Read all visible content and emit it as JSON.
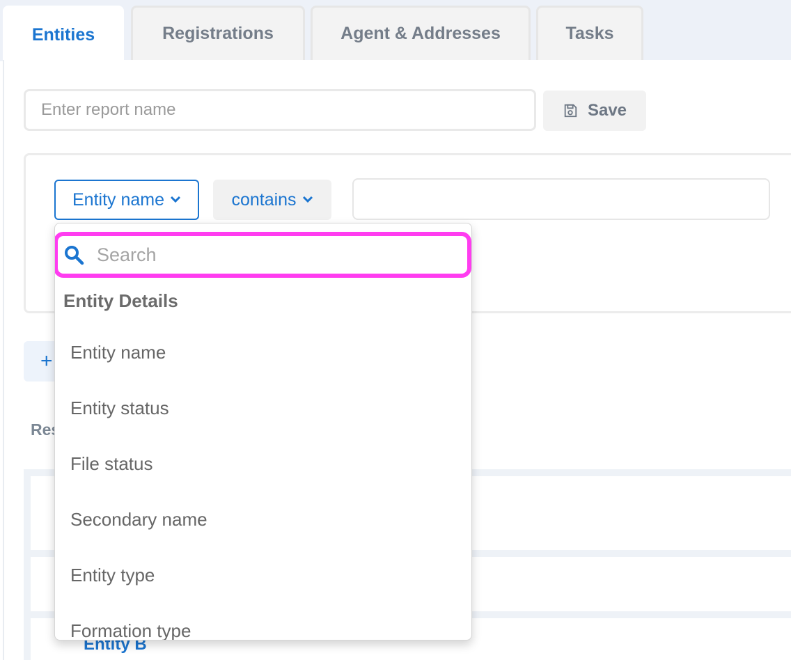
{
  "tabs": [
    {
      "label": "Entities",
      "active": true
    },
    {
      "label": "Registrations",
      "active": false
    },
    {
      "label": "Agent & Addresses",
      "active": false
    },
    {
      "label": "Tasks",
      "active": false
    }
  ],
  "report": {
    "name_placeholder": "Enter report name",
    "name_value": "",
    "save_label": "Save"
  },
  "filter": {
    "field_selected": "Entity name",
    "operator_selected": "contains",
    "value": ""
  },
  "dropdown": {
    "search_placeholder": "Search",
    "group_heading": "Entity Details",
    "items": [
      "Entity name",
      "Entity status",
      "File status",
      "Secondary name",
      "Entity type",
      "Formation type"
    ]
  },
  "background": {
    "add_symbol": "+",
    "results_label_partial": "Res",
    "visible_row_link": "Entity B"
  },
  "colors": {
    "accent": "#1b75d0",
    "highlight": "#ff3cf0",
    "tab_bg": "#edf1f8"
  },
  "icons": {
    "save": "floppy-disk-icon",
    "search": "magnifier-icon",
    "dropdown": "chevron-down-icon"
  }
}
